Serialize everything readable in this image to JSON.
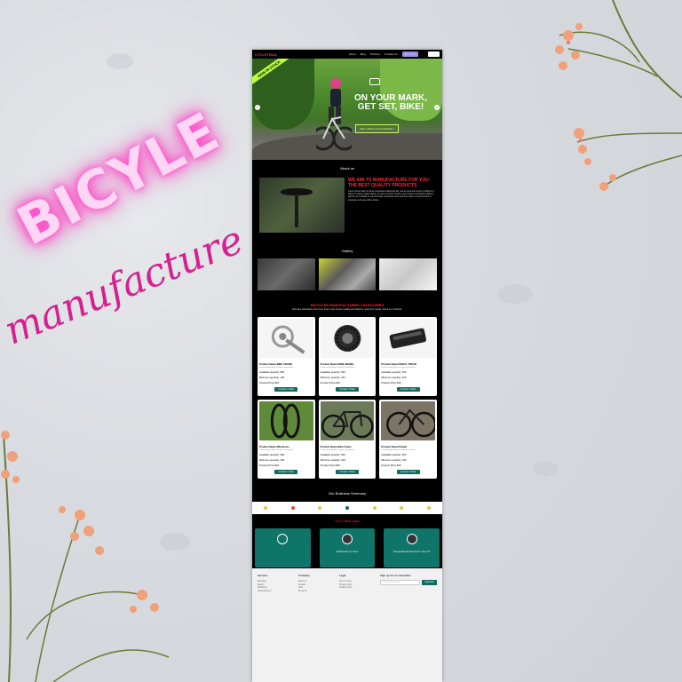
{
  "poster": {
    "neon_title": "BICYLE",
    "script_title": "manufacture"
  },
  "site": {
    "nav": {
      "logo": "CYCLETRAIL",
      "links": [
        "Home",
        "Blog",
        "Portfolio",
        "Contact Us"
      ],
      "cta": "Buy Now",
      "login": "Login"
    },
    "hero": {
      "badge": "NOW IN STOCK",
      "headline_1": "ON YOUR MARK,",
      "headline_2": "GET SET, BIKE!",
      "button": "SEE A BIKE ON EXPRESS >",
      "prev_arrow": "‹",
      "next_arrow": "›"
    },
    "about": {
      "title": "About us",
      "heading": "WE AIM TO MANUFACTURE FOR YOU THE BEST QUALITY PRODUCTS",
      "body": "Lorem ipsum dolor sit amet consectetur adipiscing elit, sed do eiusmod tempor incididunt ut labore et dolore magna aliqua. Ut enim ad minim veniam, quis nostrud exercitation ullamco laboris nisi ut aliquip ex ea commodo consequat. Duis aute irure dolor in reprehenderit in voluptate velit esse cillum dolore."
    },
    "gallery": {
      "title": "Gallery"
    },
    "categories": {
      "title": "BICYCLES MANUFACTURED CATEGORIES",
      "subtitle": "We have dedicated a lot of our time in top cutome quality and delivery, read your needs, check our products.",
      "items": [
        {
          "name": "Product Name:BMX CRANK",
          "desc": "Lorem ipsum dolor sit amet consectetur",
          "avail": "Available quantity: 500",
          "min": "Minimum quantity: 100",
          "price": "Product Price:$15",
          "button": "Contact / Order"
        },
        {
          "name": "Product Name:FREE WHEEL",
          "desc": "Lorem ipsum dolor sit amet consectetur",
          "avail": "Available quantity: 500",
          "min": "Minimum quantity: 100",
          "price": "Product Price:$15",
          "button": "Contact / Order"
        },
        {
          "name": "Product Name:PEDAL TREAD",
          "desc": "Lorem ipsum dolor sit amet consectetur",
          "avail": "Available quantity: 500",
          "min": "Minimum quantity: 100",
          "price": "Product Price:$15",
          "button": "Contact / Order"
        },
        {
          "name": "Product Name:Wheelsets",
          "desc": "Lorem ipsum dolor sit amet consectetur",
          "avail": "Available quantity: 500",
          "min": "Minimum quantity: 100",
          "price": "Product Price:$15",
          "button": "Contact / Order"
        },
        {
          "name": "Product Name:Bike Frame",
          "desc": "Lorem ipsum dolor sit amet consectetur",
          "avail": "Available quantity: 500",
          "min": "Minimum quantity: 100",
          "price": "Product Price:$15",
          "button": "Contact / Order"
        },
        {
          "name": "Product Name:Pedals",
          "desc": "Lorem ipsum dolor sit amet consectetur",
          "avail": "Available quantity: 500",
          "min": "Minimum quantity: 100",
          "price": "Product Price:$15",
          "button": "Contact / Order"
        }
      ]
    },
    "summary": {
      "title": "Our Business Summary"
    },
    "clients": {
      "title": "Our Client says",
      "items": [
        {
          "quote": ""
        },
        {
          "quote": "\"Delivered on time\""
        },
        {
          "quote": "\"Exceptional Service!!! I love it!\""
        }
      ]
    },
    "footer": {
      "columns": [
        {
          "heading": "Services",
          "items": [
            "Branding",
            "Design",
            "Marketing",
            "Advertisement"
          ]
        },
        {
          "heading": "Company",
          "items": [
            "About us",
            "Contact",
            "Jobs",
            "Press kit"
          ]
        },
        {
          "heading": "Legal",
          "items": [
            "Terms of use",
            "Privacy policy",
            "Cookie policy"
          ]
        }
      ],
      "newsletter": {
        "heading": "Sign up for our newsletter",
        "placeholder": "username@site.com",
        "button": "Subscribe"
      }
    }
  },
  "colors": {
    "accent_red": "#ff2a3d",
    "teal": "#11695f",
    "neon_pink": "#ff3fc4",
    "script_pink": "#d6208f",
    "badge_green": "#b9ff3d"
  }
}
